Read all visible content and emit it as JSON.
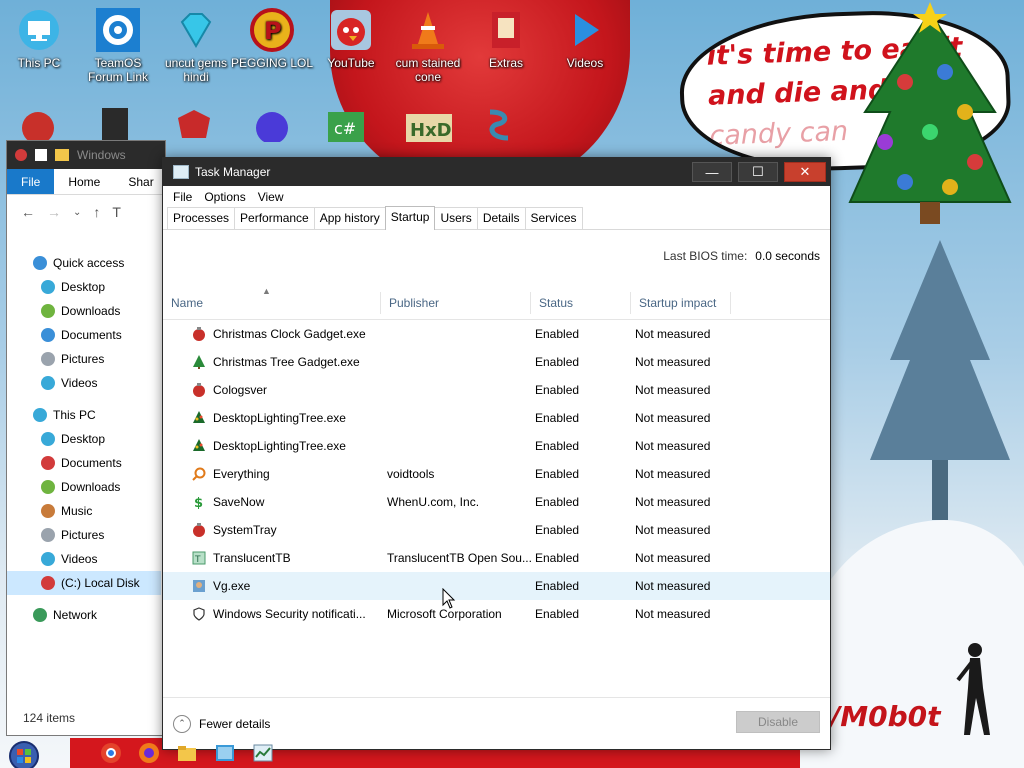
{
  "desktop": {
    "icons_row1": [
      {
        "label": "This PC",
        "icon": "this-pc-icon"
      },
      {
        "label": "TeamOS Forum Link",
        "icon": "gear-icon"
      },
      {
        "label": "uncut gems hindi",
        "icon": "diamond-icon"
      },
      {
        "label": "PEGGING LOL",
        "icon": "p-logo-icon"
      },
      {
        "label": "YouTube",
        "icon": "angry-bird-icon"
      },
      {
        "label": "cum stained cone",
        "icon": "traffic-cone-icon"
      },
      {
        "label": "Extras",
        "icon": "extras-icon"
      },
      {
        "label": "Videos",
        "icon": "play-icon"
      }
    ],
    "speech_bubble": {
      "line1": "it's time to eat it",
      "line2": "and die and",
      "line3": "candy can"
    },
    "signature": "/M0b0t"
  },
  "explorer": {
    "title": "Windows",
    "ribbon_tabs": [
      "File",
      "Home",
      "Shar"
    ],
    "address_fragment": "T",
    "nav": [
      {
        "label": "Quick access",
        "color": "#3a8fd8",
        "level": 0
      },
      {
        "label": "Desktop",
        "color": "#38a9d8",
        "level": 1
      },
      {
        "label": "Downloads",
        "color": "#6fb43f",
        "level": 1
      },
      {
        "label": "Documents",
        "color": "#3a8fd8",
        "level": 1
      },
      {
        "label": "Pictures",
        "color": "#9aa3ad",
        "level": 1
      },
      {
        "label": "Videos",
        "color": "#38a9d8",
        "level": 1
      },
      {
        "label": "This PC",
        "color": "#38a9d8",
        "level": 0
      },
      {
        "label": "Desktop",
        "color": "#38a9d8",
        "level": 1
      },
      {
        "label": "Documents",
        "color": "#d23b3b",
        "level": 1
      },
      {
        "label": "Downloads",
        "color": "#6fb43f",
        "level": 1
      },
      {
        "label": "Music",
        "color": "#c87b3a",
        "level": 1
      },
      {
        "label": "Pictures",
        "color": "#9aa3ad",
        "level": 1
      },
      {
        "label": "Videos",
        "color": "#38a9d8",
        "level": 1
      },
      {
        "label": "(C:) Local Disk",
        "color": "#d23b3b",
        "level": 1
      },
      {
        "label": "Network",
        "color": "#3a9a5a",
        "level": 0
      }
    ],
    "status": "124 items"
  },
  "taskmgr": {
    "title": "Task Manager",
    "menu": [
      "File",
      "Options",
      "View"
    ],
    "tabs": [
      "Processes",
      "Performance",
      "App history",
      "Startup",
      "Users",
      "Details",
      "Services"
    ],
    "active_tab": "Startup",
    "bios_label": "Last BIOS time:",
    "bios_value": "0.0 seconds",
    "columns": [
      "Name",
      "Publisher",
      "Status",
      "Startup impact"
    ],
    "rows": [
      {
        "name": "Christmas Clock Gadget.exe",
        "publisher": "",
        "status": "Enabled",
        "impact": "Not measured",
        "icon": "ornament-icon"
      },
      {
        "name": "Christmas Tree Gadget.exe",
        "publisher": "",
        "status": "Enabled",
        "impact": "Not measured",
        "icon": "tree-icon"
      },
      {
        "name": "Cologsver",
        "publisher": "",
        "status": "Enabled",
        "impact": "Not measured",
        "icon": "ornament-icon"
      },
      {
        "name": "DesktopLightingTree.exe",
        "publisher": "",
        "status": "Enabled",
        "impact": "Not measured",
        "icon": "lighting-tree-icon"
      },
      {
        "name": "DesktopLightingTree.exe",
        "publisher": "",
        "status": "Enabled",
        "impact": "Not measured",
        "icon": "lighting-tree-icon"
      },
      {
        "name": "Everything",
        "publisher": "voidtools",
        "status": "Enabled",
        "impact": "Not measured",
        "icon": "magnifier-icon"
      },
      {
        "name": "SaveNow",
        "publisher": "WhenU.com, Inc.",
        "status": "Enabled",
        "impact": "Not measured",
        "icon": "dollar-icon"
      },
      {
        "name": "SystemTray",
        "publisher": "",
        "status": "Enabled",
        "impact": "Not measured",
        "icon": "ornament-icon"
      },
      {
        "name": "TranslucentTB",
        "publisher": "TranslucentTB Open Sou...",
        "status": "Enabled",
        "impact": "Not measured",
        "icon": "translucenttb-icon"
      },
      {
        "name": "Vg.exe",
        "publisher": "",
        "status": "Enabled",
        "impact": "Not measured",
        "icon": "vg-icon"
      },
      {
        "name": "Windows Security notificati...",
        "publisher": "Microsoft Corporation",
        "status": "Enabled",
        "impact": "Not measured",
        "icon": "shield-icon"
      }
    ],
    "fewer_details": "Fewer details",
    "disable_label": "Disable"
  },
  "colors": {
    "titlebar": "#2b2b2b",
    "close_button": "#c8402d",
    "file_tab": "#1979ca",
    "hover_row": "#e5f3fb",
    "header_text": "#4a6785"
  }
}
